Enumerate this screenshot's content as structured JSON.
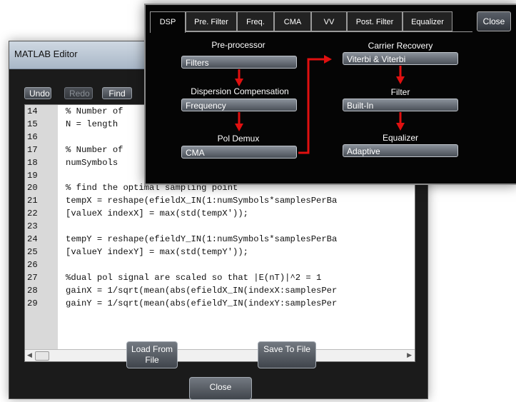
{
  "editor": {
    "title": "MATLAB Editor",
    "toolbar": {
      "undo": "Undo",
      "redo": "Redo",
      "find": "Find"
    },
    "lines": [
      {
        "num": "14",
        "text": "% Number of"
      },
      {
        "num": "15",
        "text": "N = length"
      },
      {
        "num": "16",
        "text": ""
      },
      {
        "num": "17",
        "text": "% Number of"
      },
      {
        "num": "18",
        "text": "numSymbols"
      },
      {
        "num": "19",
        "text": ""
      },
      {
        "num": "20",
        "text": "% find the optimal sampling point"
      },
      {
        "num": "21",
        "text": "tempX = reshape(efieldX_IN(1:numSymbols*samplesPerBa"
      },
      {
        "num": "22",
        "text": "[valueX indexX] = max(std(tempX'));"
      },
      {
        "num": "23",
        "text": ""
      },
      {
        "num": "24",
        "text": "tempY = reshape(efieldY_IN(1:numSymbols*samplesPerBa"
      },
      {
        "num": "25",
        "text": "[valueY indexY] = max(std(tempY'));"
      },
      {
        "num": "26",
        "text": ""
      },
      {
        "num": "27",
        "text": "%dual pol signal are scaled so that |E(nT)|^2 = 1"
      },
      {
        "num": "28",
        "text": "gainX = 1/sqrt(mean(abs(efieldX_IN(indexX:samplesPer"
      },
      {
        "num": "29",
        "text": "gainY = 1/sqrt(mean(abs(efieldY_IN(indexY:samplesPer"
      }
    ],
    "load_button": "Load From File",
    "save_button": "Save To File",
    "close_button": "Close"
  },
  "dsp": {
    "tabs": [
      "DSP",
      "Pre. Filter",
      "Freq.",
      "CMA",
      "VV",
      "Post. Filter",
      "Equalizer"
    ],
    "active_tab": "DSP",
    "close": "Close",
    "left_chain": [
      {
        "label": "Pre-processor",
        "value": "Filters"
      },
      {
        "label": "Dispersion Compensation",
        "value": "Frequency"
      },
      {
        "label": "Pol Demux",
        "value": "CMA"
      }
    ],
    "right_chain": [
      {
        "label": "Carrier Recovery",
        "value": "Viterbi & Viterbi"
      },
      {
        "label": "Filter",
        "value": "Built-In"
      },
      {
        "label": "Equalizer",
        "value": "Adaptive"
      }
    ],
    "arrow_color": "#e01010"
  }
}
